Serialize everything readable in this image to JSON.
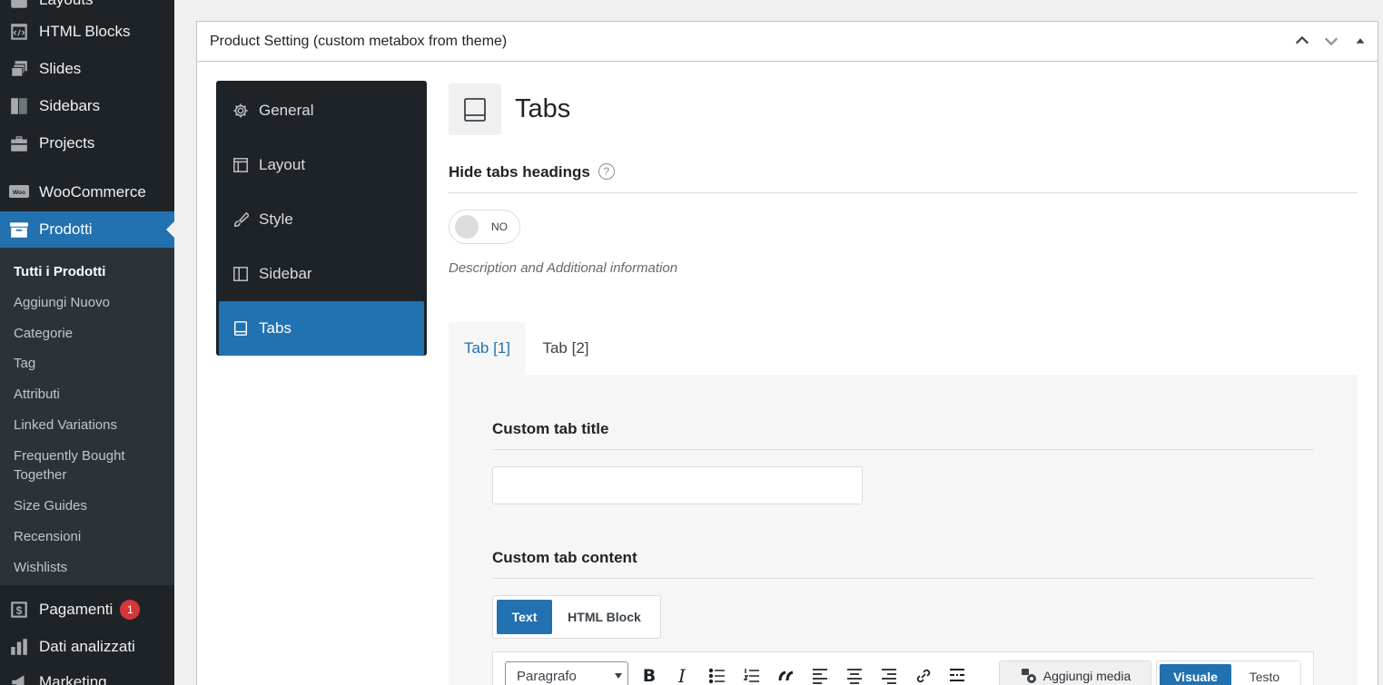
{
  "admin_menu": {
    "items": [
      {
        "label": "Layouts",
        "icon": "layout-icon"
      },
      {
        "label": "HTML Blocks",
        "icon": "code-block-icon"
      },
      {
        "label": "Slides",
        "icon": "slides-icon"
      },
      {
        "label": "Sidebars",
        "icon": "sidebar-icon"
      },
      {
        "label": "Projects",
        "icon": "briefcase-icon"
      },
      {
        "label": "WooCommerce",
        "icon": "woo-icon"
      },
      {
        "label": "Prodotti",
        "icon": "archive-icon"
      },
      {
        "label": "Pagamenti",
        "icon": "payments-icon",
        "badge": "1"
      },
      {
        "label": "Dati analizzati",
        "icon": "analytics-icon"
      },
      {
        "label": "Marketing",
        "icon": "megaphone-icon"
      }
    ],
    "submenu": [
      "Tutti i Prodotti",
      "Aggiungi Nuovo",
      "Categorie",
      "Tag",
      "Attributi",
      "Linked Variations",
      "Frequently Bought Together",
      "Size Guides",
      "Recensioni",
      "Wishlists"
    ]
  },
  "metabox": {
    "title": "Product Setting (custom metabox from theme)"
  },
  "settings_nav": [
    {
      "label": "General",
      "icon": "gear-icon"
    },
    {
      "label": "Layout",
      "icon": "layout-icon"
    },
    {
      "label": "Style",
      "icon": "brush-icon"
    },
    {
      "label": "Sidebar",
      "icon": "sidebar-icon"
    },
    {
      "label": "Tabs",
      "icon": "tabs-icon"
    }
  ],
  "panel": {
    "title": "Tabs",
    "hide_tabs_label": "Hide tabs headings",
    "help_glyph": "?",
    "toggle_state": "NO",
    "description": "Description and Additional information",
    "tabs": [
      "Tab [1]",
      "Tab [2]"
    ],
    "custom_title_label": "Custom tab title",
    "custom_title_value": "",
    "custom_content_label": "Custom tab content",
    "content_types": [
      "Text",
      "HTML Block"
    ],
    "editor": {
      "format_select": "Paragrafo",
      "add_media": "Aggiungi media",
      "modes": [
        "Visuale",
        "Testo"
      ]
    }
  },
  "colors": {
    "accent": "#2271b1",
    "sidebar_bg": "#1d2327",
    "submenu_bg": "#2c3338",
    "badge": "#d63638"
  }
}
